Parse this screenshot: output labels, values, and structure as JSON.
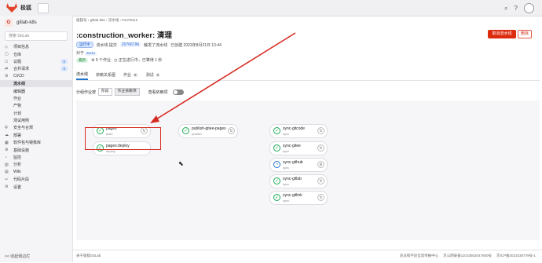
{
  "topbar": {
    "brand": "极狐",
    "icons": [
      "search-icon",
      "help-icon",
      "avatar"
    ]
  },
  "sidebar": {
    "project_initial": "G",
    "project_name": "gitlab-k8s",
    "search_placeholder": "搜索 GitLab",
    "items": [
      {
        "icon": "◇",
        "label": "项目信息",
        "count": ""
      },
      {
        "icon": "▢",
        "label": "仓库",
        "count": ""
      },
      {
        "icon": "◻",
        "label": "议题",
        "count": "0"
      },
      {
        "icon": "⇄",
        "label": "合并请求",
        "count": "0"
      },
      {
        "icon": "⚙",
        "label": "CI/CD",
        "count": ""
      },
      {
        "label": "流水线",
        "sub": true,
        "active": true
      },
      {
        "label": "编辑器",
        "sub": true
      },
      {
        "label": "作业",
        "sub": true
      },
      {
        "label": "产物",
        "sub": true
      },
      {
        "label": "计划",
        "sub": true
      },
      {
        "label": "测试用例",
        "sub": true
      },
      {
        "icon": "⛨",
        "label": "安全与合规",
        "count": ""
      },
      {
        "icon": "☁",
        "label": "部署",
        "count": ""
      },
      {
        "icon": "▦",
        "label": "软件包与镜像库",
        "count": ""
      },
      {
        "icon": "⚙",
        "label": "基础设施",
        "count": ""
      },
      {
        "icon": "◔",
        "label": "监控",
        "count": ""
      },
      {
        "icon": "▥",
        "label": "分析",
        "count": ""
      },
      {
        "icon": "▤",
        "label": "Wiki",
        "count": ""
      },
      {
        "icon": "✂",
        "label": "代码片段",
        "count": ""
      },
      {
        "icon": "⚙",
        "label": "设置",
        "count": ""
      }
    ],
    "collapse_label": "<< 收起侧边栏"
  },
  "main": {
    "breadcrumb": "极狐号 › gitlab-k8s › 流水线 › #1479412",
    "title": ":construction_worker: 清理",
    "cancel_label": "取消流水线",
    "delete_label": "删除",
    "status_badge": "运行中",
    "meta_text1": "流水线 提交",
    "commit_sha": "20766796",
    "meta_text2": "触发了流水线",
    "meta_text3": "已创建 2023年8月21日 13:44",
    "for_label": "对于",
    "branch": "main",
    "latest_badge": "最新",
    "jobs_count": "9 个作业",
    "progress_text": "正在进行中，已等待 1 秒",
    "tabs": [
      {
        "label": "流水线",
        "count": ""
      },
      {
        "label": "依赖关系图",
        "count": ""
      },
      {
        "label": "作业",
        "count": "9"
      },
      {
        "label": "测试",
        "count": "0"
      }
    ],
    "group_label": "分组作业按",
    "group_stage": "阶段",
    "group_deps": "作业依赖项",
    "show_deps_label": "查看依赖项"
  },
  "jobs": [
    {
      "name": "pages",
      "stage": "build",
      "status": "success",
      "action": "retry-icon"
    },
    {
      "name": "pages:deploy",
      "stage": "deploy",
      "status": "success",
      "action": ""
    },
    {
      "name": "publish-gitee-pages",
      "stage": "publish",
      "status": "success",
      "action": "retry-icon"
    },
    {
      "name": "sync-gitcode",
      "stage": "sync",
      "status": "success",
      "action": "retry-icon"
    },
    {
      "name": "sync-gitee",
      "stage": "sync",
      "status": "success",
      "action": "retry-icon"
    },
    {
      "name": "sync-github",
      "stage": "sync",
      "status": "running",
      "action": "cancel-icon"
    },
    {
      "name": "sync-gitlab",
      "stage": "sync",
      "status": "success",
      "action": "retry-icon"
    },
    {
      "name": "sync-gitlink",
      "stage": "sync",
      "status": "success",
      "action": "retry-icon"
    }
  ],
  "footer": {
    "left": "关于极狐GitLab",
    "center": "违法和不良信息举报中心",
    "icp1": "京公网安备11010502047940号",
    "icp2": "京ICP备2021038779号-1"
  },
  "colors": {
    "accent": "#1f75cb",
    "danger": "#dd2b0e",
    "success": "#1aaa55",
    "annotation": "#d62a20"
  }
}
